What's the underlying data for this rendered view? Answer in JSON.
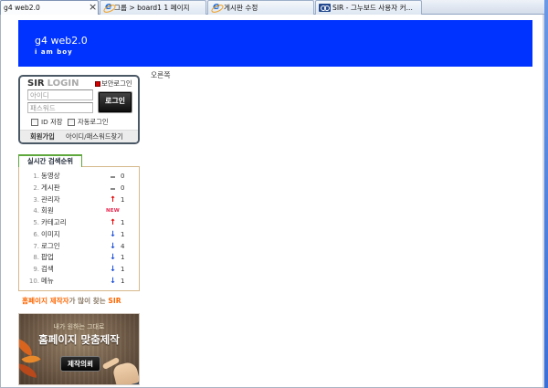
{
  "browser": {
    "tabs": [
      {
        "title": "g4 web2.0",
        "active": true,
        "icon": "none",
        "close_icon": "close-icon"
      },
      {
        "title": "그룹 > board1 1 페이지",
        "active": false,
        "icon": "ie-icon"
      },
      {
        "title": "게시판 수정",
        "active": false,
        "icon": "ie-icon"
      },
      {
        "title": "SIR - 그누보드 사용자 커...",
        "active": false,
        "icon": "sir-site-icon"
      }
    ]
  },
  "header": {
    "title": "g4 web2.0",
    "subtitle": "i am boy"
  },
  "login": {
    "brand": "SIR",
    "label": "LOGIN",
    "secure_icon": "secure-login-icon",
    "secure_text": "보안로그인",
    "id_placeholder": "아이디",
    "pw_placeholder": "패스워드",
    "submit": "로그인",
    "save_id": "ID 저장",
    "auto_login": "자동로그인",
    "join": "회원가입",
    "find": "아이디/패스워드찾기"
  },
  "ranking": {
    "tab_label": "실시간 검색순위",
    "items": [
      {
        "rank": "1.",
        "keyword": "동영상",
        "trend": "same",
        "change": "0"
      },
      {
        "rank": "2.",
        "keyword": "게시판",
        "trend": "same",
        "change": "0"
      },
      {
        "rank": "3.",
        "keyword": "관리자",
        "trend": "up",
        "change": "1"
      },
      {
        "rank": "4.",
        "keyword": "회원",
        "trend": "new",
        "badge": "NEW"
      },
      {
        "rank": "5.",
        "keyword": "카테고리",
        "trend": "up",
        "change": "1"
      },
      {
        "rank": "6.",
        "keyword": "이미지",
        "trend": "down",
        "change": "1"
      },
      {
        "rank": "7.",
        "keyword": "로그인",
        "trend": "down",
        "change": "4"
      },
      {
        "rank": "8.",
        "keyword": "팝업",
        "trend": "down",
        "change": "1"
      },
      {
        "rank": "9.",
        "keyword": "검색",
        "trend": "down",
        "change": "1"
      },
      {
        "rank": "10.",
        "keyword": "메뉴",
        "trend": "down",
        "change": "1"
      }
    ]
  },
  "promo": {
    "highlight": "홈페이지 제작자",
    "middle": "가 많이 찾는 ",
    "brand": "SIR"
  },
  "banner": {
    "line1": "내가 원하는 그대로",
    "line2": "홈페이지 맞춤제작",
    "button": "제작의뢰"
  },
  "main": {
    "content": "오른쪽"
  },
  "colors": {
    "header_bg": "#0033ff",
    "login_border": "#4a5866",
    "secure_icon": "#d40000",
    "ranking_tab_border": "#5fa83d",
    "ranking_box_border": "#d6b88c",
    "trend_up": "#e00000",
    "trend_down": "#1f4fd6",
    "trend_same": "#888888",
    "new_badge": "#e8254e",
    "promo_accent": "#ff6600",
    "window_frame": "#3b6fd8"
  }
}
